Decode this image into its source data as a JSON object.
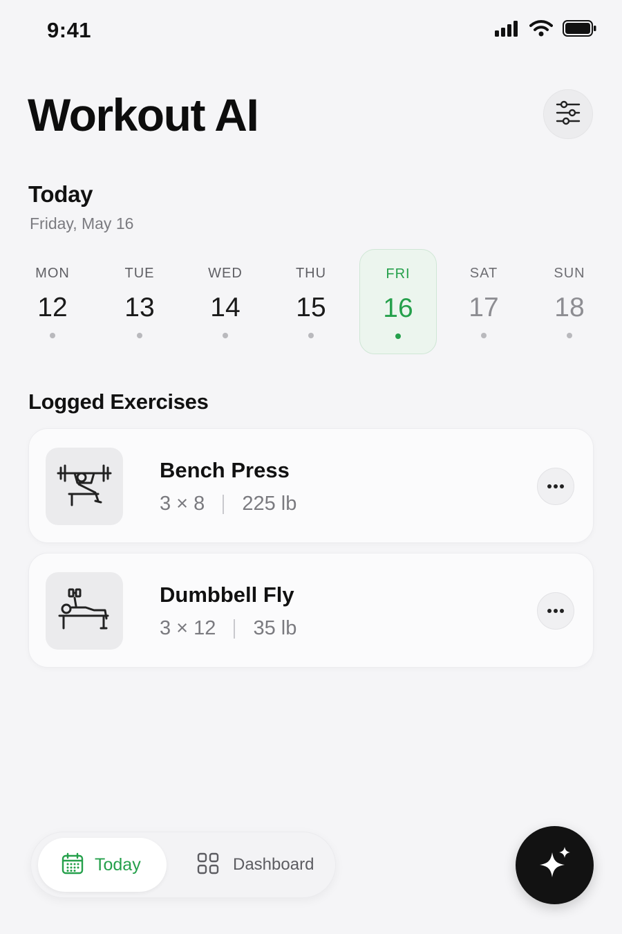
{
  "status_bar": {
    "time": "9:41",
    "icons": [
      "cellular-signal-icon",
      "wifi-icon",
      "battery-icon"
    ]
  },
  "header": {
    "title": "Workout AI",
    "settings_icon": "sliders-icon"
  },
  "today": {
    "title": "Today",
    "date": "Friday, May 16"
  },
  "week": [
    {
      "dow": "MON",
      "day": "12",
      "state": "past"
    },
    {
      "dow": "TUE",
      "day": "13",
      "state": "past"
    },
    {
      "dow": "WED",
      "day": "14",
      "state": "past"
    },
    {
      "dow": "THU",
      "day": "15",
      "state": "past"
    },
    {
      "dow": "FRI",
      "day": "16",
      "state": "selected"
    },
    {
      "dow": "SAT",
      "day": "17",
      "state": "future"
    },
    {
      "dow": "SUN",
      "day": "18",
      "state": "future"
    }
  ],
  "logged": {
    "title": "Logged Exercises",
    "items": [
      {
        "name": "Bench Press",
        "sets_reps": "3 × 8",
        "weight": "225 lb",
        "icon": "bench-press-icon"
      },
      {
        "name": "Dumbbell Fly",
        "sets_reps": "3 × 12",
        "weight": "35 lb",
        "icon": "dumbbell-fly-icon"
      }
    ],
    "more_icon": "ellipsis-icon"
  },
  "tabbar": {
    "today_label": "Today",
    "dashboard_label": "Dashboard",
    "today_icon": "calendar-icon",
    "dashboard_icon": "grid-icon"
  },
  "fab": {
    "icon": "sparkle-icon"
  },
  "colors": {
    "accent": "#25a04b",
    "background": "#f5f5f7",
    "fab": "#121212"
  }
}
